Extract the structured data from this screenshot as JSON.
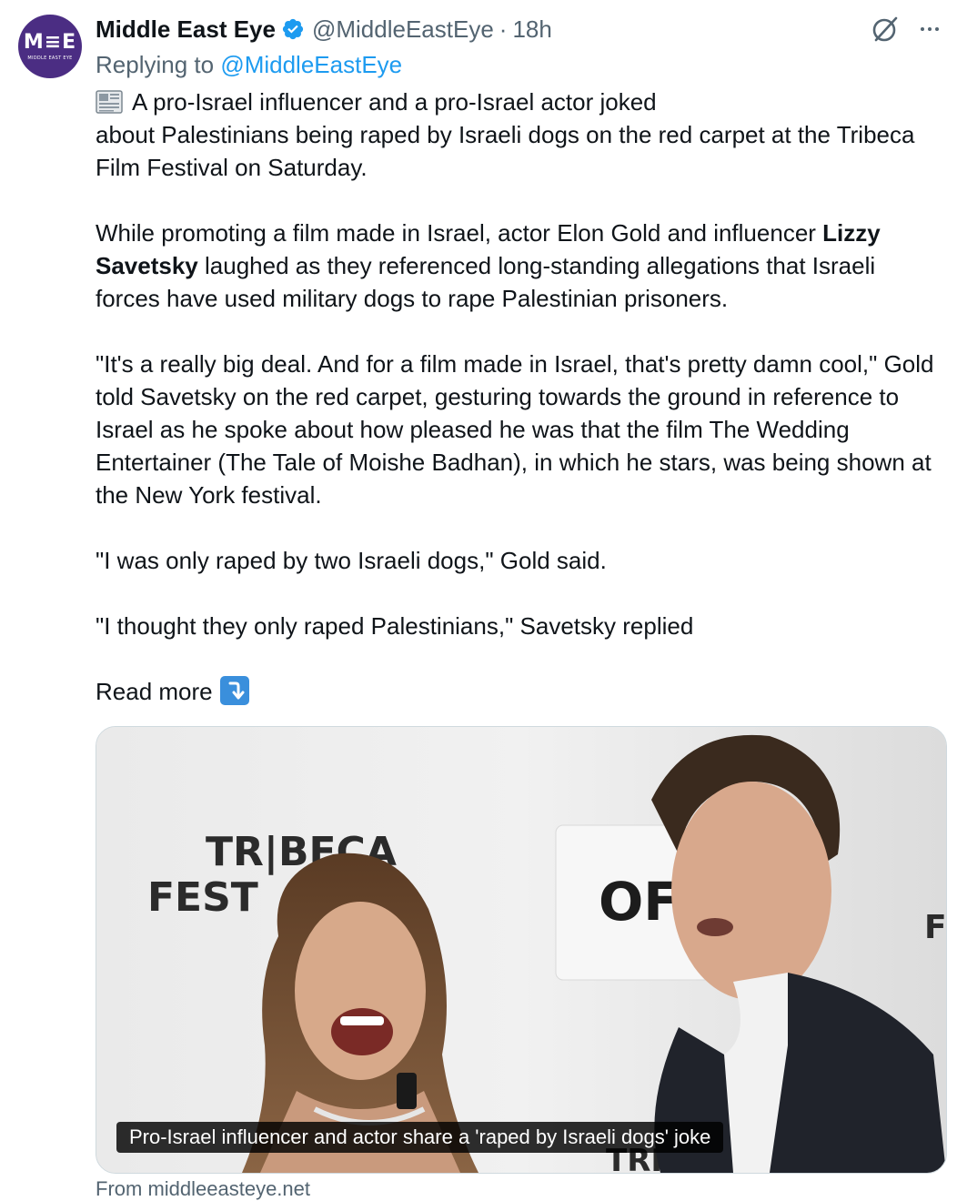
{
  "account": {
    "display_name": "Middle East Eye",
    "handle": "@MiddleEastEye",
    "separator": "·",
    "time": "18h",
    "avatar_mark": "M≡E",
    "avatar_sub": "MIDDLE EAST EYE",
    "verified_color": "#1d9bf0",
    "brand_color": "#4b2d83"
  },
  "reply": {
    "prefix": "Replying to",
    "target": "@MiddleEastEye"
  },
  "post": {
    "p1_line1": "A pro-Israel influencer and a pro-Israel actor joked",
    "p1_rest": "about Palestinians being raped by Israeli dogs on the red carpet at the Tribeca Film Festival on Saturday.",
    "p2_before": "While promoting a film made in Israel, actor Elon Gold and influencer",
    "p2_bold": "Lizzy Savetsky",
    "p2_after": "laughed as they referenced long-standing allegations that Israeli forces have used military dogs to rape Palestinian prisoners.",
    "p3": "\"It's a really big deal. And for a film made in Israel, that's pretty damn cool,\" Gold told Savetsky on the red carpet, gesturing towards the ground in reference to Israel as he spoke about how pleased he was that the film The Wedding Entertainer (The Tale of Moishe Badhan), in which he stars, was being shown at the New York festival.",
    "p4": "\"I was only raped by two Israeli dogs,\" Gold said.",
    "p5": "\"I thought they only raped Palestinians,\" Savetsky replied",
    "read_more": "Read more"
  },
  "media": {
    "backdrop_text_1": "TR|BECA",
    "backdrop_text_2": "FEST",
    "backdrop_text_3": "OF",
    "backdrop_text_4": "F",
    "backdrop_text_5": "TRIE",
    "caption": "Pro-Israel influencer and actor share a 'raped by Israeli dogs' joke"
  },
  "link_card": {
    "source": "From middleeasteye.net"
  },
  "icons": {
    "verified": "verified-badge-icon",
    "grok": "grok-icon",
    "more": "more-options-icon",
    "news": "newspaper-icon",
    "read_more": "arrow-down-right-icon"
  },
  "colors": {
    "link": "#1d9bf0",
    "secondary_text": "#536471",
    "primary_text": "#0f1419"
  }
}
